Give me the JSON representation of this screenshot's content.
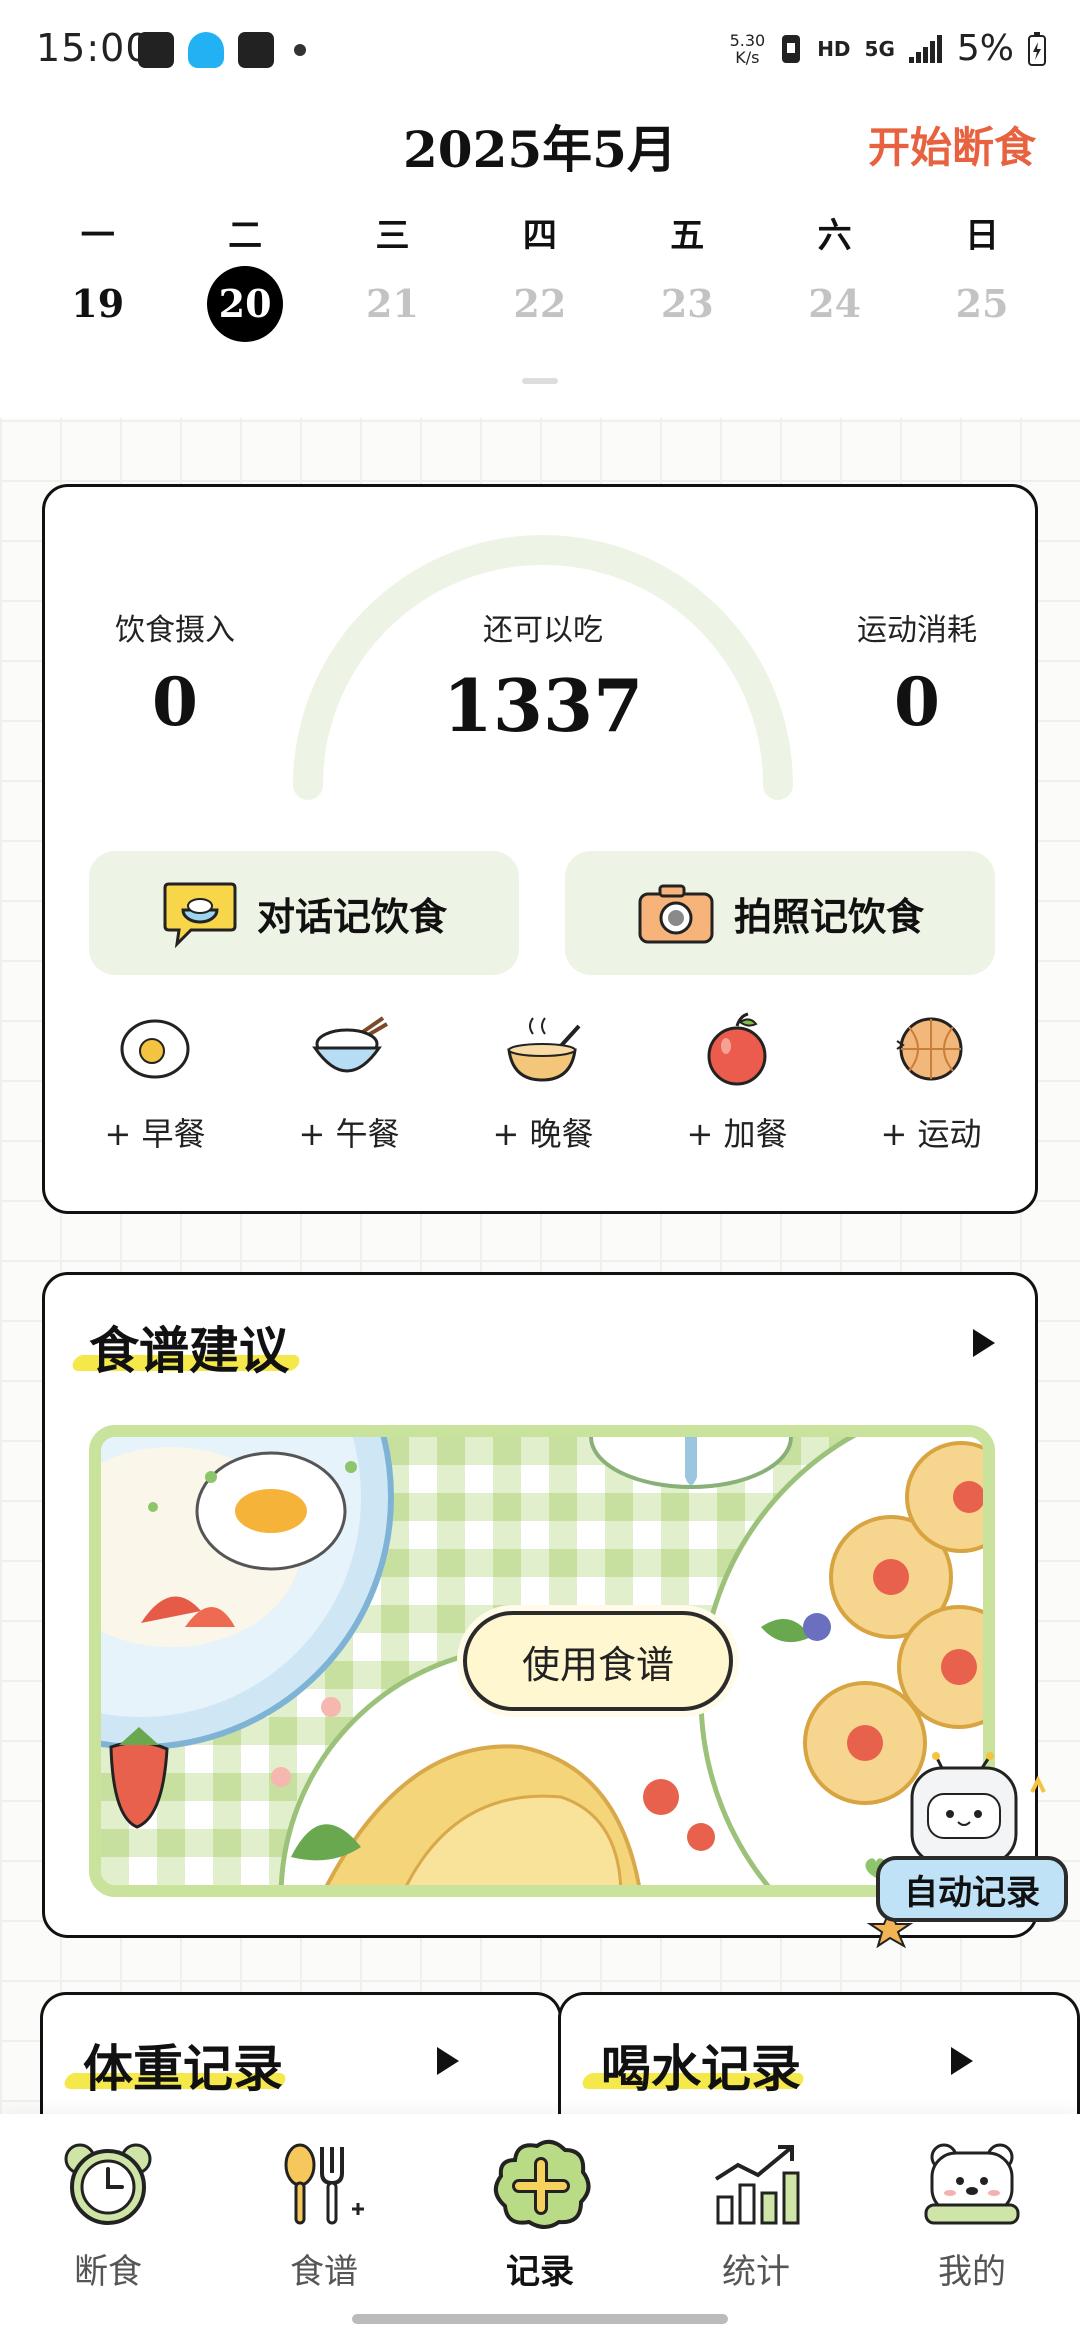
{
  "status_bar": {
    "time": "15:00",
    "net_speed_value": "5.30",
    "net_speed_unit": "K/s",
    "hd": "HD",
    "network": "5G",
    "battery": "5%",
    "icons": [
      "gallery-icon",
      "qq-icon",
      "task-icon",
      "notification-dot-icon",
      "nfc-icon",
      "signal-icon",
      "battery-icon"
    ]
  },
  "header": {
    "month_title": "2025年5月",
    "start_fasting": "开始断食",
    "weekdays": [
      "一",
      "二",
      "三",
      "四",
      "五",
      "六",
      "日"
    ],
    "dates": [
      "19",
      "20",
      "21",
      "22",
      "23",
      "24",
      "25"
    ],
    "selected_date": "20"
  },
  "calories": {
    "intake_label": "饮食摄入",
    "intake_value": "0",
    "remaining_label": "还可以吃",
    "remaining_value": "1337",
    "burned_label": "运动消耗",
    "burned_value": "0",
    "chat_log_label": "对话记饮食",
    "photo_log_label": "拍照记饮食",
    "meals": [
      {
        "label": "+ 早餐",
        "icon": "egg-icon"
      },
      {
        "label": "+ 午餐",
        "icon": "rice-bowl-icon"
      },
      {
        "label": "+ 晚餐",
        "icon": "soup-bowl-icon"
      },
      {
        "label": "+ 加餐",
        "icon": "apple-icon"
      },
      {
        "label": "+ 运动",
        "icon": "basketball-icon"
      }
    ]
  },
  "recipe": {
    "title": "食谱建议",
    "use_recipe": "使用食谱",
    "auto_record": "自动记录"
  },
  "weight_card": {
    "title": "体重记录"
  },
  "water_card": {
    "title": "喝水记录"
  },
  "nav": [
    {
      "label": "断食",
      "icon": "alarm-clock-icon"
    },
    {
      "label": "食谱",
      "icon": "spoon-fork-icon"
    },
    {
      "label": "记录",
      "icon": "add-record-icon",
      "active": true
    },
    {
      "label": "统计",
      "icon": "chart-icon"
    },
    {
      "label": "我的",
      "icon": "bear-icon"
    }
  ],
  "colors": {
    "accent": "#e8623f",
    "soft_green": "#eef4e5",
    "banner_green": "#c9e29c",
    "highlight_yellow": "#f4e84a"
  }
}
